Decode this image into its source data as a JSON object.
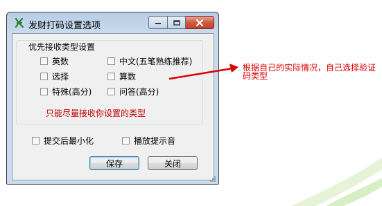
{
  "window": {
    "title": "发财打码设置选项"
  },
  "group": {
    "title": "优先接收类型设置",
    "options": [
      {
        "label": "英数",
        "checked": false
      },
      {
        "label": "中文(五笔熟练推荐)",
        "checked": false
      },
      {
        "label": "选择",
        "checked": false
      },
      {
        "label": "算数",
        "checked": false
      },
      {
        "label": "特殊(高分)",
        "checked": false
      },
      {
        "label": "问答(高分)",
        "checked": false
      }
    ],
    "hint": "只能尽量接收你设置的类型"
  },
  "options": {
    "minimize_after_submit": {
      "label": "提交后最小化",
      "checked": false
    },
    "play_sound": {
      "label": "播放提示音",
      "checked": false
    }
  },
  "buttons": {
    "save": "保存",
    "close": "关闭"
  },
  "annotation": {
    "text": "根据自己的实际情况，自己选择验证码类型"
  },
  "colors": {
    "annotation": "#dd0000",
    "hint": "#c00000",
    "close_button": "#c2412a"
  }
}
